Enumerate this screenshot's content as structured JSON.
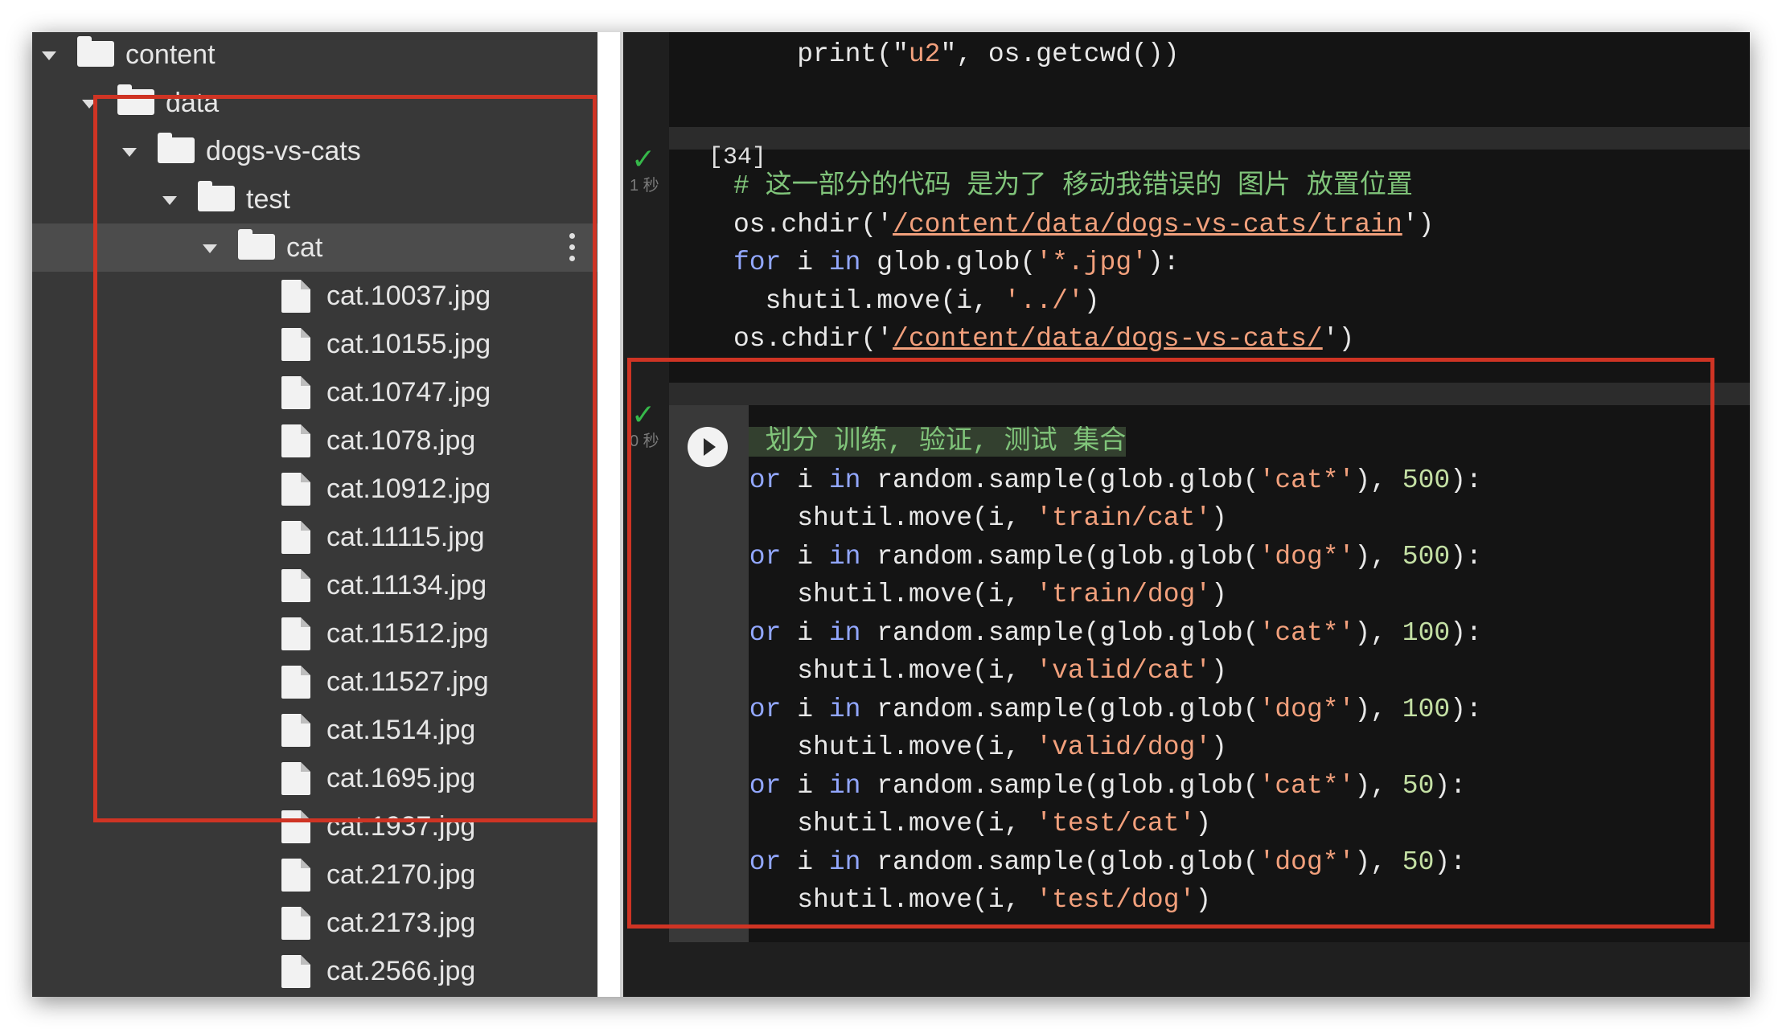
{
  "tree": [
    {
      "type": "folder",
      "label": "content",
      "expanded": true,
      "depth": 0
    },
    {
      "type": "folder",
      "label": "data",
      "expanded": true,
      "depth": 1
    },
    {
      "type": "folder",
      "label": "dogs-vs-cats",
      "expanded": true,
      "depth": 2
    },
    {
      "type": "folder",
      "label": "test",
      "expanded": true,
      "depth": 3
    },
    {
      "type": "folder",
      "label": "cat",
      "expanded": true,
      "depth": 4,
      "selected": true,
      "menu_icon": "more-vert-icon"
    },
    {
      "type": "file",
      "label": "cat.10037.jpg",
      "depth": 5
    },
    {
      "type": "file",
      "label": "cat.10155.jpg",
      "depth": 5
    },
    {
      "type": "file",
      "label": "cat.10747.jpg",
      "depth": 5
    },
    {
      "type": "file",
      "label": "cat.1078.jpg",
      "depth": 5
    },
    {
      "type": "file",
      "label": "cat.10912.jpg",
      "depth": 5
    },
    {
      "type": "file",
      "label": "cat.11115.jpg",
      "depth": 5
    },
    {
      "type": "file",
      "label": "cat.11134.jpg",
      "depth": 5
    },
    {
      "type": "file",
      "label": "cat.11512.jpg",
      "depth": 5
    },
    {
      "type": "file",
      "label": "cat.11527.jpg",
      "depth": 5
    },
    {
      "type": "file",
      "label": "cat.1514.jpg",
      "depth": 5
    },
    {
      "type": "file",
      "label": "cat.1695.jpg",
      "depth": 5
    },
    {
      "type": "file",
      "label": "cat.1937.jpg",
      "depth": 5
    },
    {
      "type": "file",
      "label": "cat.2170.jpg",
      "depth": 5
    },
    {
      "type": "file",
      "label": "cat.2173.jpg",
      "depth": 5
    },
    {
      "type": "file",
      "label": "cat.2566.jpg",
      "depth": 5
    }
  ],
  "cells": [
    {
      "id": "cell-0",
      "lines": [
        [
          [
            "",
            "    print(\""
          ],
          [
            "str",
            "u2"
          ],
          [
            "",
            "\", os.getcwd())"
          ]
        ]
      ]
    },
    {
      "id": "cell-34",
      "execution_count": "[34]",
      "status_check": "✓",
      "status_time": "1 秒",
      "lines": [
        [
          [
            "comment",
            "# 这一部分的代码 是为了 移动我错误的 图片 放置位置"
          ]
        ],
        [
          [
            "",
            "os.chdir('"
          ],
          [
            "str path",
            "/content/data/dogs-vs-cats/train"
          ],
          [
            "",
            "')"
          ]
        ],
        [
          [
            "kw",
            "for"
          ],
          [
            "",
            " i "
          ],
          [
            "kw",
            "in"
          ],
          [
            "",
            " glob.glob("
          ],
          [
            "str",
            "'*.jpg'"
          ],
          [
            "",
            "):"
          ]
        ],
        [
          [
            "",
            "  shutil.move(i, "
          ],
          [
            "str",
            "'../'"
          ],
          [
            "",
            ")"
          ]
        ],
        [
          [
            "",
            "os.chdir('"
          ],
          [
            "str path",
            "/content/data/dogs-vs-cats/"
          ],
          [
            "",
            "')"
          ]
        ]
      ]
    },
    {
      "id": "cell-active",
      "status_check": "✓",
      "status_time": "0 秒",
      "run_icon": "play-circle-icon",
      "lines": [
        [
          [
            "comment hl",
            "# 划分 训练, 验证, 测试 集合"
          ]
        ],
        [
          [
            "kw",
            "for"
          ],
          [
            "",
            " i "
          ],
          [
            "kw",
            "in"
          ],
          [
            "",
            " random.sample(glob.glob("
          ],
          [
            "str",
            "'cat*'"
          ],
          [
            "",
            "), "
          ],
          [
            "num",
            "500"
          ],
          [
            "",
            "):"
          ]
        ],
        [
          [
            "",
            "    shutil.move(i, "
          ],
          [
            "str",
            "'train/cat'"
          ],
          [
            "",
            ")"
          ]
        ],
        [
          [
            "kw",
            "for"
          ],
          [
            "",
            " i "
          ],
          [
            "kw",
            "in"
          ],
          [
            "",
            " random.sample(glob.glob("
          ],
          [
            "str",
            "'dog*'"
          ],
          [
            "",
            "), "
          ],
          [
            "num",
            "500"
          ],
          [
            "",
            "):"
          ]
        ],
        [
          [
            "",
            "    shutil.move(i, "
          ],
          [
            "str",
            "'train/dog'"
          ],
          [
            "",
            ")"
          ]
        ],
        [
          [
            "kw",
            "for"
          ],
          [
            "",
            " i "
          ],
          [
            "kw",
            "in"
          ],
          [
            "",
            " random.sample(glob.glob("
          ],
          [
            "str",
            "'cat*'"
          ],
          [
            "",
            "), "
          ],
          [
            "num",
            "100"
          ],
          [
            "",
            "):"
          ]
        ],
        [
          [
            "",
            "    shutil.move(i, "
          ],
          [
            "str",
            "'valid/cat'"
          ],
          [
            "",
            ")"
          ]
        ],
        [
          [
            "kw",
            "for"
          ],
          [
            "",
            " i "
          ],
          [
            "kw",
            "in"
          ],
          [
            "",
            " random.sample(glob.glob("
          ],
          [
            "str",
            "'dog*'"
          ],
          [
            "",
            "), "
          ],
          [
            "num",
            "100"
          ],
          [
            "",
            "):"
          ]
        ],
        [
          [
            "",
            "    shutil.move(i, "
          ],
          [
            "str",
            "'valid/dog'"
          ],
          [
            "",
            ")"
          ]
        ],
        [
          [
            "kw",
            "for"
          ],
          [
            "",
            " i "
          ],
          [
            "kw",
            "in"
          ],
          [
            "",
            " random.sample(glob.glob("
          ],
          [
            "str",
            "'cat*'"
          ],
          [
            "",
            "), "
          ],
          [
            "num",
            "50"
          ],
          [
            "",
            "):"
          ]
        ],
        [
          [
            "",
            "    shutil.move(i, "
          ],
          [
            "str",
            "'test/cat'"
          ],
          [
            "",
            ")"
          ]
        ],
        [
          [
            "kw",
            "for"
          ],
          [
            "",
            " i "
          ],
          [
            "kw",
            "in"
          ],
          [
            "",
            " random.sample(glob.glob("
          ],
          [
            "str",
            "'dog*'"
          ],
          [
            "",
            "), "
          ],
          [
            "num",
            "50"
          ],
          [
            "",
            "):"
          ]
        ],
        [
          [
            "",
            "    shutil.move(i, "
          ],
          [
            "str",
            "'test/dog'"
          ],
          [
            "",
            ")"
          ]
        ]
      ]
    }
  ],
  "colors": {
    "keyword": "#92a7ff",
    "string": "#f2a07c",
    "number": "#c4e0a4",
    "comment": "#80c47a",
    "highlight_box": "#cf3424",
    "status_ok": "#36b84a"
  }
}
